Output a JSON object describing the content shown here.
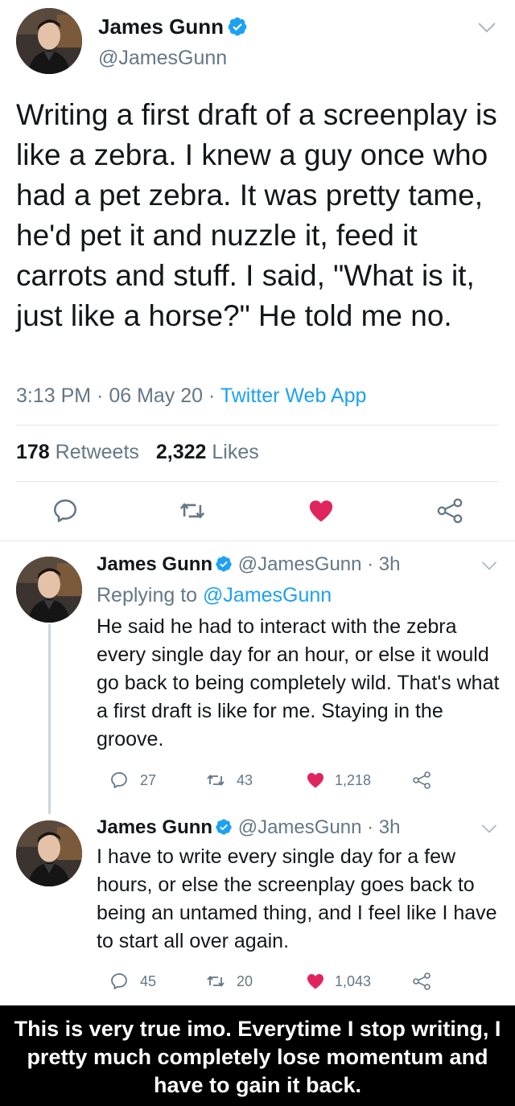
{
  "main_tweet": {
    "name": "James Gunn",
    "handle": "@JamesGunn",
    "text": "Writing a first draft of a screenplay is like a zebra. I knew a guy once who had a pet zebra. It was pretty tame, he'd pet it and nuzzle it, feed it carrots and stuff. I said, \"What is it, just like a horse?\" He told me no.",
    "time": "3:13 PM · 06 May 20 · ",
    "app": "Twitter Web App",
    "retweets_count": "178",
    "retweets_label": "Retweets",
    "likes_count": "2,322",
    "likes_label": "Likes",
    "icons": [
      "reply-icon",
      "retweet-icon",
      "heart-icon",
      "share-icon"
    ]
  },
  "replies": [
    {
      "name": "James Gunn",
      "handle": "@JamesGunn · 3h",
      "replying_prefix": "Replying to ",
      "replying_to": "@JamesGunn",
      "text": "He said he had to interact with the zebra every single day for an hour, or else it would go back to being completely wild. That's what a first draft is like for me. Staying in the groove.",
      "replies": "27",
      "retweets": "43",
      "likes": "1,218"
    },
    {
      "name": "James Gunn",
      "handle": "@JamesGunn · 3h",
      "text": "I have to write every single day for a few hours, or else the screenplay goes back to being an untamed thing, and I feel like I have to start all over again.",
      "replies": "45",
      "retweets": "20",
      "likes": "1,043"
    }
  ],
  "caption": "This is very true imo. Everytime I stop writing, I pretty much completely lose momentum and have to gain it back.",
  "colors": {
    "accent": "#1da1f2",
    "like": "#e0245e",
    "muted": "#657786",
    "divider": "#e1e8ed"
  }
}
